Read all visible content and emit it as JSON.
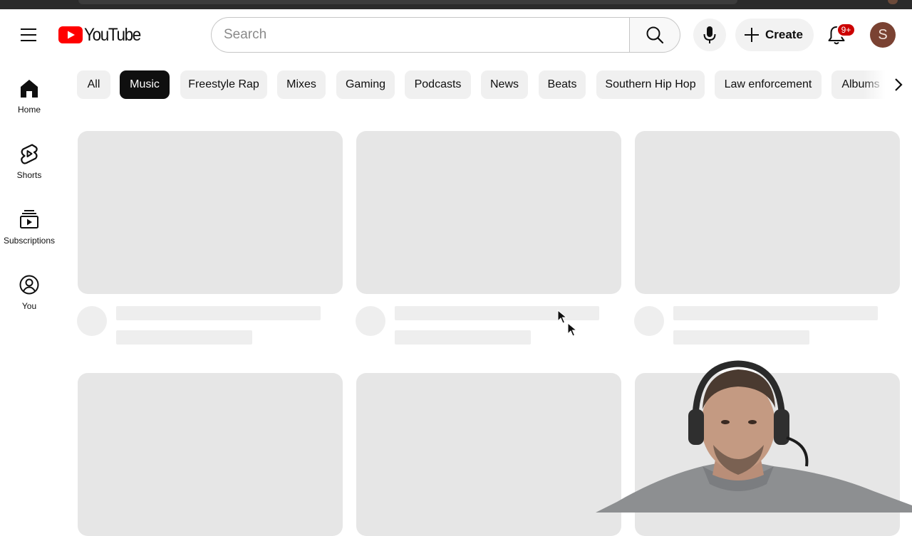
{
  "app": {
    "brand": "YouTube"
  },
  "search": {
    "placeholder": "Search"
  },
  "header": {
    "create_label": "Create",
    "notification_count": "9+",
    "avatar_initial": "S"
  },
  "guide": {
    "items": [
      {
        "label": "Home",
        "icon": "home-icon"
      },
      {
        "label": "Shorts",
        "icon": "shorts-icon"
      },
      {
        "label": "Subscriptions",
        "icon": "subscriptions-icon"
      },
      {
        "label": "You",
        "icon": "you-icon"
      }
    ]
  },
  "chips": {
    "items": [
      {
        "label": "All",
        "selected": false
      },
      {
        "label": "Music",
        "selected": true
      },
      {
        "label": "Freestyle Rap",
        "selected": false
      },
      {
        "label": "Mixes",
        "selected": false
      },
      {
        "label": "Gaming",
        "selected": false
      },
      {
        "label": "Podcasts",
        "selected": false
      },
      {
        "label": "News",
        "selected": false
      },
      {
        "label": "Beats",
        "selected": false
      },
      {
        "label": "Southern Hip Hop",
        "selected": false
      },
      {
        "label": "Law enforcement",
        "selected": false
      },
      {
        "label": "Albums",
        "selected": false
      }
    ]
  },
  "colors": {
    "brand_red": "#ff0000",
    "chip_active_bg": "#0f0f0f",
    "skeleton": "#e6e6e6",
    "badge": "#cc0000"
  }
}
